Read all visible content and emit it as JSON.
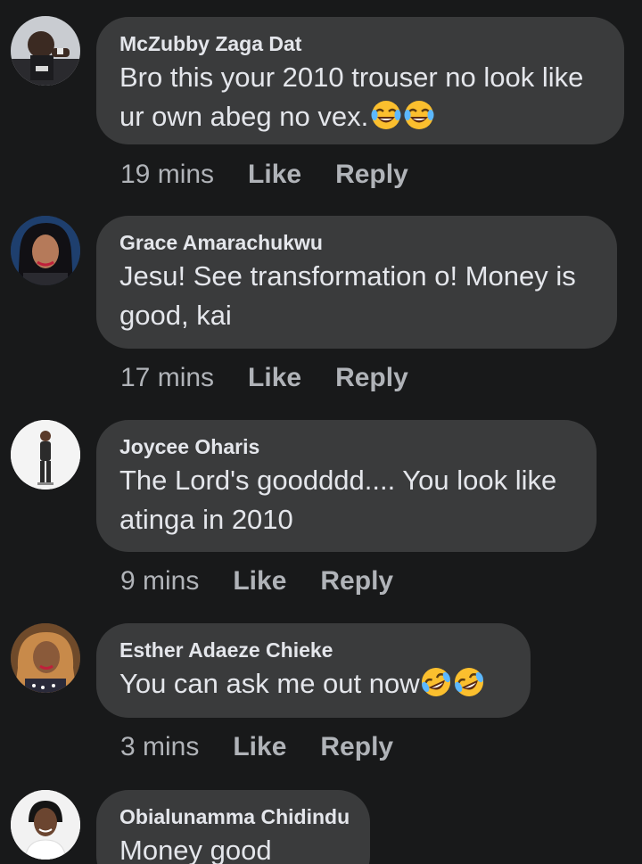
{
  "comments": [
    {
      "author": "McZubby Zaga Dat",
      "text": "Bro this your 2010 trouser no look like ur own abeg no vex.",
      "emojis": [
        "tears-of-joy-emoji",
        "tears-of-joy-emoji"
      ],
      "time": "19 mins",
      "like_label": "Like",
      "reply_label": "Reply"
    },
    {
      "author": "Grace Amarachukwu",
      "text": "Jesu! See transformation o! Money is good, kai",
      "emojis": [],
      "time": "17 mins",
      "like_label": "Like",
      "reply_label": "Reply"
    },
    {
      "author": "Joycee Oharis",
      "text": "The Lord's goodddd.... You look like atinga in 2010",
      "emojis": [],
      "time": "9 mins",
      "like_label": "Like",
      "reply_label": "Reply"
    },
    {
      "author": "Esther Adaeze Chieke",
      "text": "You can ask me out now",
      "emojis": [
        "rolling-on-floor-laughing-emoji",
        "rolling-on-floor-laughing-emoji"
      ],
      "time": "3 mins",
      "like_label": "Like",
      "reply_label": "Reply"
    },
    {
      "author": "Obialunamma Chidindu",
      "text": "Money good",
      "emojis": [],
      "time": "",
      "like_label": "",
      "reply_label": ""
    }
  ],
  "colors": {
    "background": "#18191a",
    "bubble": "#3a3b3c",
    "primary_text": "#e4e6eb",
    "secondary_text": "#b0b3b8"
  }
}
